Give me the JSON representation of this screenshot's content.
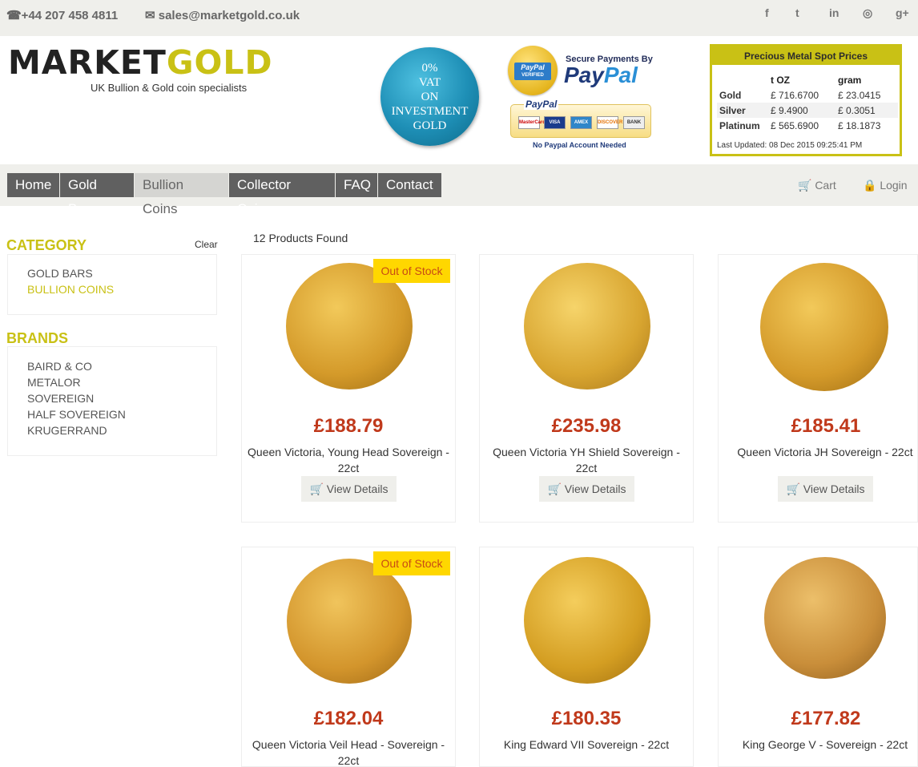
{
  "topbar": {
    "phone": "☎+44 207 458 4811",
    "email": "✉ sales@marketgold.co.uk",
    "social_icons": [
      "facebook-icon",
      "twitter-icon",
      "linkedin-icon",
      "dribbble-icon",
      "google-plus-icon"
    ],
    "social_glyphs": [
      "f",
      "t",
      "in",
      "◎",
      "g+"
    ]
  },
  "header": {
    "logo_market": "MARKET",
    "logo_gold": "GOLD",
    "tagline": "UK Bullion & Gold coin specialists",
    "vat_lines": [
      "0%",
      "VAT",
      "ON",
      "INVESTMENT",
      "GOLD"
    ],
    "paypal": {
      "seal_title": "PayPal",
      "seal_sub": "VERIFIED",
      "secure_text": "Secure Payments By",
      "logo_pay": "Pay",
      "logo_pal": "Pal",
      "box_title": "PayPal",
      "cards": [
        "MasterCard",
        "VISA",
        "AMEX",
        "DISCOVER",
        "BANK"
      ],
      "note": "No Paypal Account Needed"
    }
  },
  "spot_prices": {
    "title": "Precious Metal Spot Prices",
    "columns": [
      "",
      "t OZ",
      "gram"
    ],
    "rows": [
      {
        "metal": "Gold",
        "toz": "£ 716.6700",
        "gram": "£ 23.0415"
      },
      {
        "metal": "Silver",
        "toz": "£ 9.4900",
        "gram": "£ 0.3051"
      },
      {
        "metal": "Platinum",
        "toz": "£ 565.6900",
        "gram": "£ 18.1873"
      }
    ],
    "updated": "Last Updated: 08 Dec 2015 09:25:41 PM"
  },
  "nav": {
    "items": [
      "Home",
      "Gold Bars",
      "Bullion Coins",
      "Collector Coins",
      "FAQ",
      "Contact"
    ],
    "active": "Bullion Coins",
    "cart": "🛒 Cart",
    "login": "🔒 Login"
  },
  "sidebar": {
    "category_title": "CATEGORY",
    "clear": "Clear",
    "categories": [
      "GOLD BARS",
      "BULLION COINS"
    ],
    "selected_category": "BULLION COINS",
    "brands_title": "BRANDS",
    "brands": [
      "BAIRD & CO",
      "METALOR",
      "SOVEREIGN",
      "HALF SOVEREIGN",
      "KRUGERRAND"
    ]
  },
  "products": {
    "found": "12 Products Found",
    "view_label": "🛒 View Details",
    "out_of_stock_label": "Out of Stock",
    "items": [
      {
        "price": "£188.79",
        "name": "Queen Victoria, Young Head Sovereign - 22ct",
        "out_of_stock": true
      },
      {
        "price": "£235.98",
        "name": "Queen Victoria YH Shield Sovereign - 22ct",
        "out_of_stock": false
      },
      {
        "price": "£185.41",
        "name": "Queen Victoria JH Sovereign - 22ct",
        "out_of_stock": false
      },
      {
        "price": "£182.04",
        "name": "Queen Victoria Veil Head - Sovereign - 22ct",
        "out_of_stock": true
      },
      {
        "price": "£180.35",
        "name": "King Edward VII Sovereign - 22ct",
        "out_of_stock": false
      },
      {
        "price": "£177.82",
        "name": "King George V - Sovereign - 22ct",
        "out_of_stock": false
      }
    ]
  },
  "colors": {
    "accent": "#c9c115",
    "price": "#c0391b",
    "badge": "#ffd700",
    "nav": "#606060"
  }
}
